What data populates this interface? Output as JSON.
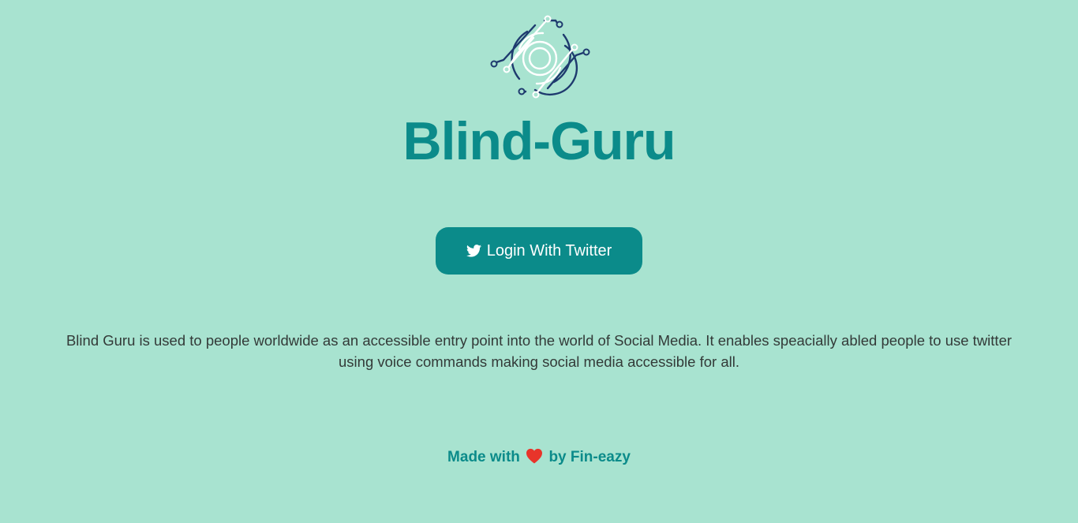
{
  "app": {
    "title": "Blind-Guru"
  },
  "logo": {
    "icon": "circuit-eye-logo-icon",
    "colors": {
      "dark": "#1e3a6e",
      "light": "#ffffff"
    }
  },
  "login_button": {
    "label": "Login With Twitter",
    "icon": "twitter-bird-icon"
  },
  "description": {
    "text": "Blind Guru is used to people worldwide as an accessible entry point into the world of Social Media. It enables speacially abled people to use twitter using voice commands making social media accessible for all."
  },
  "footer": {
    "prefix": "Made with",
    "icon": "heart-icon",
    "suffix": "by Fin-eazy"
  },
  "colors": {
    "background": "#a8e3d0",
    "accent": "#0b8b8a",
    "text": "#333a38",
    "heart": "#e8342a"
  }
}
